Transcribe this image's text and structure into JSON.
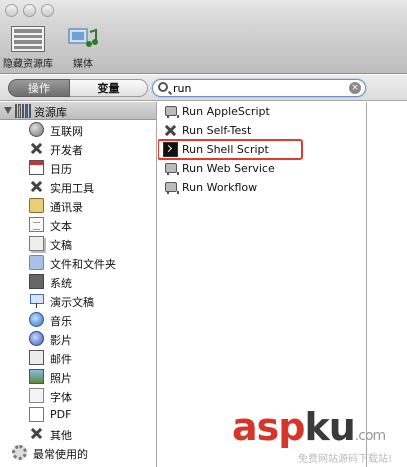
{
  "window": {
    "buttons": [
      "close",
      "minimize",
      "zoom"
    ]
  },
  "toolbar": {
    "items": [
      {
        "label": "隐藏资源库",
        "icon": "library-icon"
      },
      {
        "label": "媒体",
        "icon": "media-icon"
      }
    ]
  },
  "tabs": {
    "actions": "操作",
    "variables": "变量"
  },
  "search": {
    "value": "run",
    "clear_glyph": "×"
  },
  "library": {
    "header": "资源库",
    "categories": [
      {
        "label": "互联网",
        "icon": "globe-icon"
      },
      {
        "label": "开发者",
        "icon": "tools-icon"
      },
      {
        "label": "日历",
        "icon": "calendar-icon"
      },
      {
        "label": "实用工具",
        "icon": "tools-icon"
      },
      {
        "label": "通讯录",
        "icon": "address-book-icon"
      },
      {
        "label": "文本",
        "icon": "text-doc-icon"
      },
      {
        "label": "文稿",
        "icon": "documents-icon"
      },
      {
        "label": "文件和文件夹",
        "icon": "folder-icon"
      },
      {
        "label": "系统",
        "icon": "system-icon"
      },
      {
        "label": "演示文稿",
        "icon": "presentation-icon"
      },
      {
        "label": "音乐",
        "icon": "music-icon"
      },
      {
        "label": "影片",
        "icon": "movie-icon"
      },
      {
        "label": "邮件",
        "icon": "mail-icon"
      },
      {
        "label": "照片",
        "icon": "photo-icon"
      },
      {
        "label": "字体",
        "icon": "font-icon"
      },
      {
        "label": "PDF",
        "icon": "pdf-icon"
      },
      {
        "label": "其他",
        "icon": "tools-icon"
      }
    ],
    "footer": "最常使用的"
  },
  "results": {
    "items": [
      {
        "label": "Run AppleScript",
        "icon": "automator-robot-icon"
      },
      {
        "label": "Run Self-Test",
        "icon": "tools-icon"
      },
      {
        "label": "Run Shell Script",
        "icon": "terminal-icon",
        "highlighted": true
      },
      {
        "label": "Run Web Service",
        "icon": "automator-robot-icon"
      },
      {
        "label": "Run Workflow",
        "icon": "automator-robot-icon"
      }
    ]
  },
  "watermark": {
    "main_a": "asp",
    "main_b": "ku",
    "main_c": ".com",
    "sub": "免费网站源码下载站!"
  },
  "colors": {
    "highlight": "#e33a2b",
    "watermark_red": "#d8352a",
    "search_focus": "#6f8fc0"
  }
}
